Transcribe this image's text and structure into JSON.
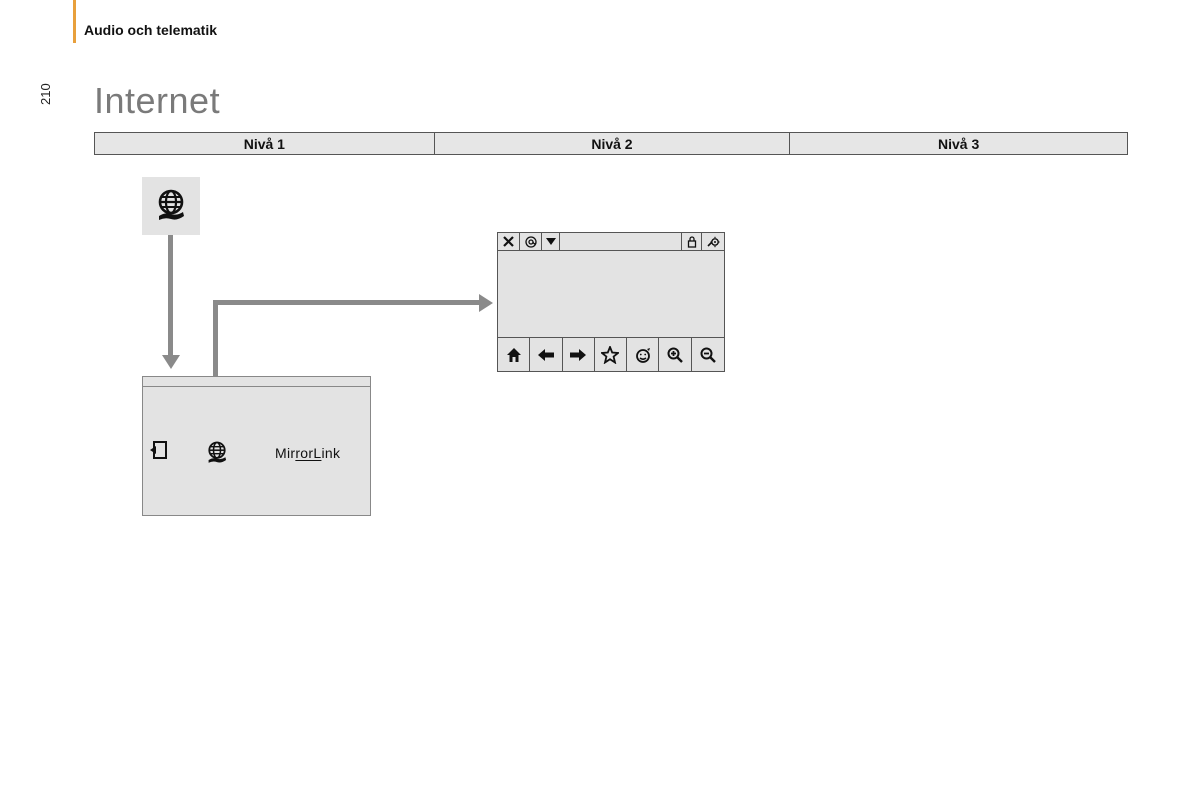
{
  "header": {
    "section": "Audio och telematik"
  },
  "page_number": "210",
  "title": "Internet",
  "levels": {
    "col1": "Nivå 1",
    "col2": "Nivå 2",
    "col3": "Nivå 3"
  },
  "menu_panel": {
    "mirror_prefix": "Mir",
    "mirror_mid": "rorL",
    "mirror_suffix": "ink"
  }
}
